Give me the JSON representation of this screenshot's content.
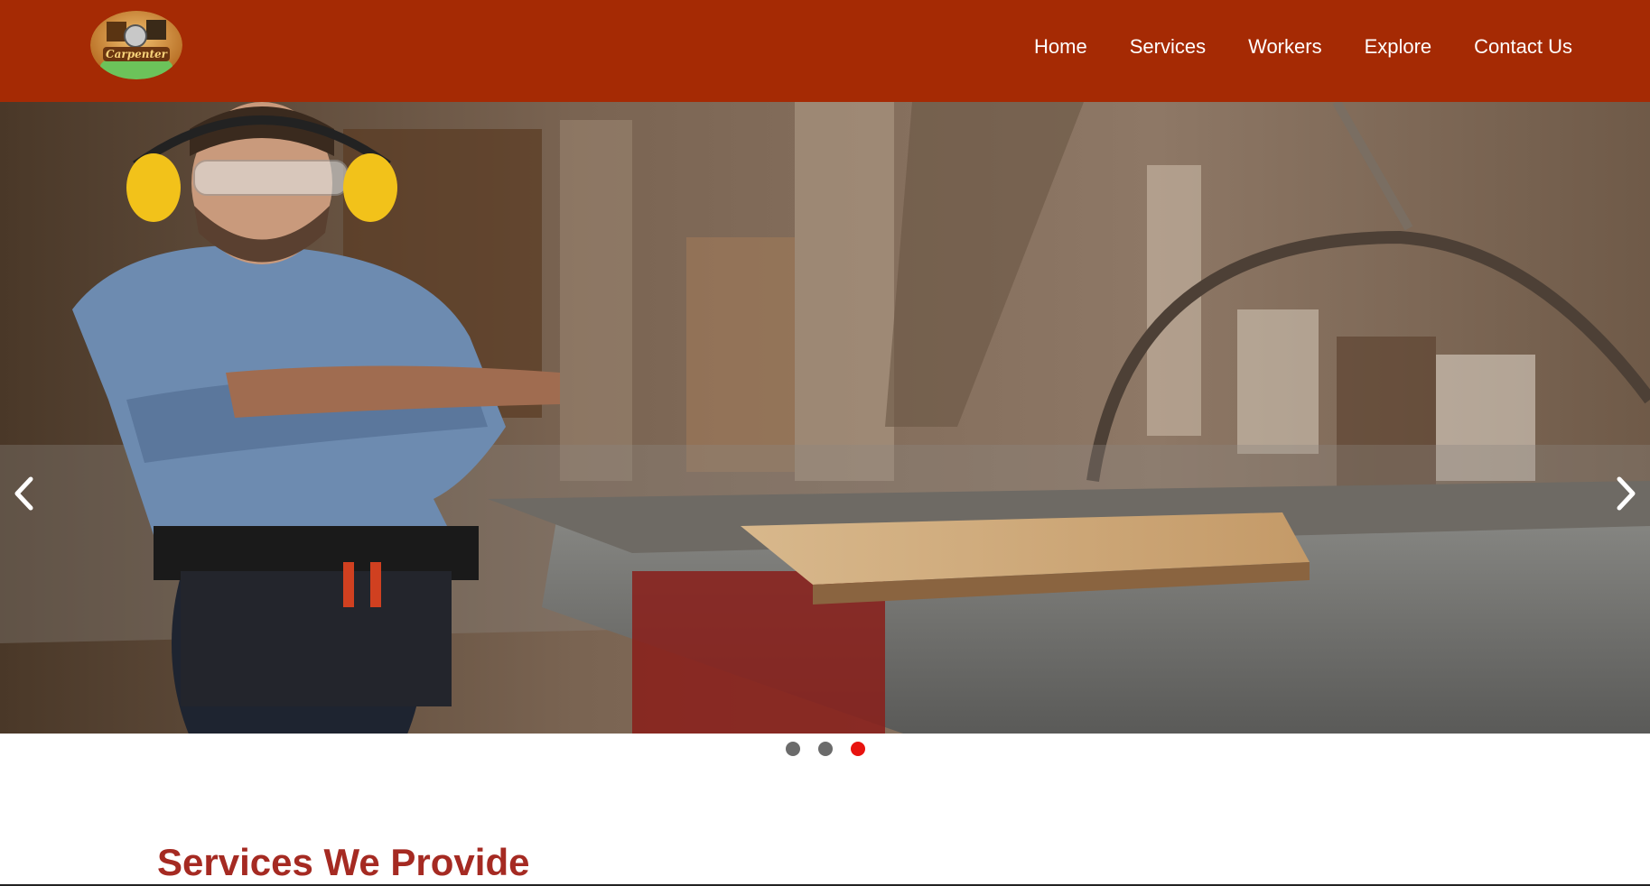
{
  "brand": {
    "logo_text": "Carpenter",
    "header_color": "#a52a04"
  },
  "nav": {
    "items": [
      {
        "label": "Home"
      },
      {
        "label": "Services"
      },
      {
        "label": "Workers"
      },
      {
        "label": "Explore"
      },
      {
        "label": "Contact Us"
      }
    ]
  },
  "carousel": {
    "prev_icon": "chevron-left-icon",
    "next_icon": "chevron-right-icon",
    "slide_count": 3,
    "active_index": 3,
    "active_dot_color": "#e8130f",
    "inactive_dot_color": "#6b6b6b"
  },
  "section": {
    "title": "Services We Provide",
    "title_color": "#a52a22"
  }
}
